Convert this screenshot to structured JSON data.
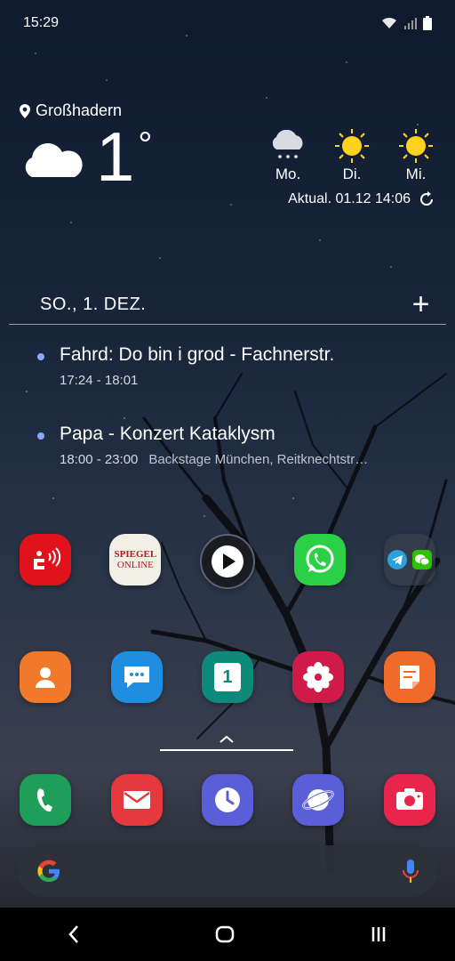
{
  "status_bar": {
    "time": "15:29"
  },
  "weather": {
    "location": "Großhadern",
    "temperature": "1",
    "degree_symbol": "°",
    "forecast": [
      {
        "day": "Mo.",
        "icon": "snow-cloud-icon"
      },
      {
        "day": "Di.",
        "icon": "sun-icon"
      },
      {
        "day": "Mi.",
        "icon": "sun-icon"
      }
    ],
    "updated": "Aktual. 01.12 14:06"
  },
  "agenda": {
    "date": "SO., 1. DEZ.",
    "add_label": "+",
    "events": [
      {
        "title": "Fahrd: Do bin i grod - Fachnerstr.",
        "time": "17:24 - 18:01",
        "location": ""
      },
      {
        "title": "Papa - Konzert Kataklysm",
        "time": "18:00 - 23:00",
        "location": "Backstage München, Reitknechtstr…"
      }
    ]
  },
  "apps": {
    "row1": [
      "sparkasse-app",
      "spiegel-online-app",
      "video-player-app",
      "whatsapp-app",
      "telegram-wechat-folder"
    ],
    "row2": [
      "contacts-app",
      "messages-app",
      "calendar-app",
      "gallery-app",
      "notes-app"
    ],
    "dock": [
      "phone-app",
      "email-app",
      "clock-app",
      "internet-app",
      "camera-app"
    ],
    "spiegel_text_1": "SPIEGEL",
    "spiegel_text_2": "ONLINE",
    "calendar_day": "1"
  },
  "colors": {
    "sparkasse": "#e2121c",
    "whatsapp": "#2cd046",
    "contacts": "#f07a2a",
    "messages": "#1f8ee0",
    "calendar": "#0e8a7a",
    "gallery": "#d01a4a",
    "notes": "#f06a2a",
    "phone": "#1e9e58",
    "email": "#e6393d",
    "clock": "#5a5ed8",
    "internet": "#5a5ed8",
    "camera": "#e8264c"
  }
}
